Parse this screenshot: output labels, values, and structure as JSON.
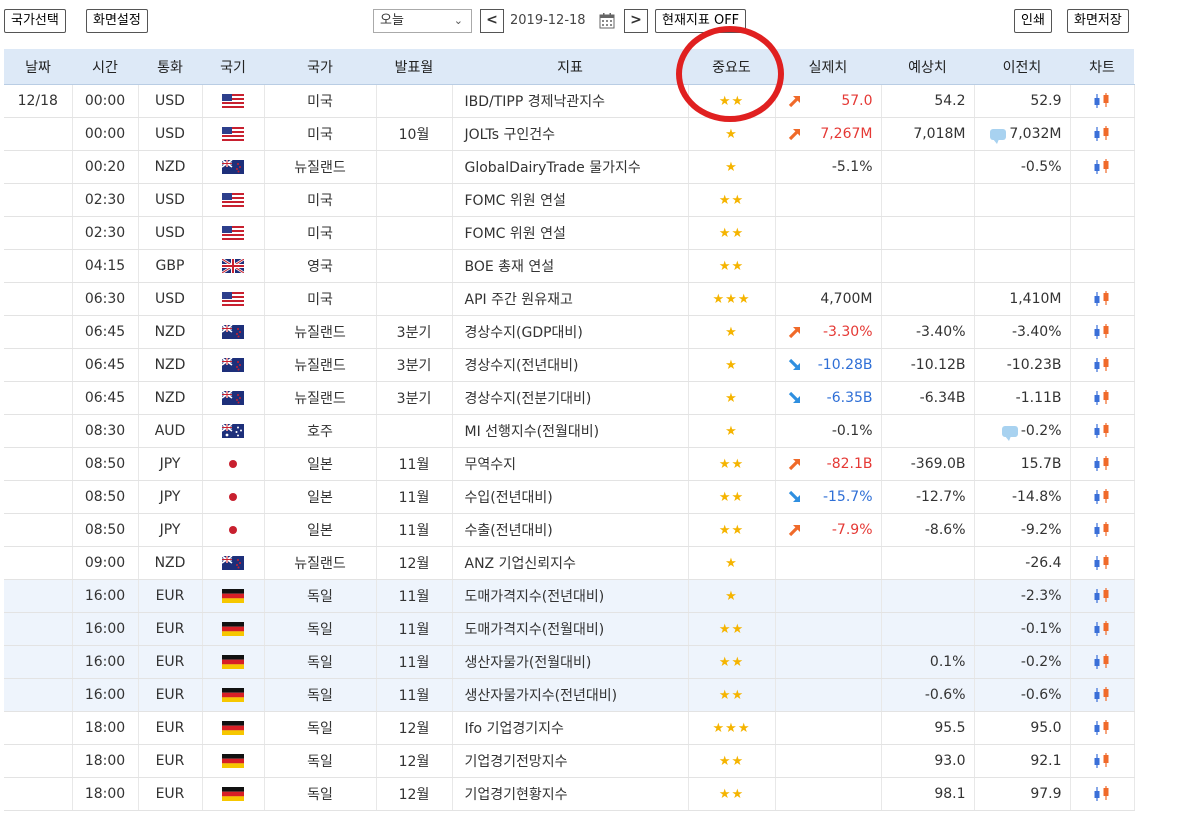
{
  "toolbar": {
    "country_select": "국가선택",
    "screen_settings": "화면설정",
    "period": "오늘",
    "date": "2019-12-18",
    "indicator_toggle": "현재지표 OFF",
    "print": "인쇄",
    "save_screen": "화면저장"
  },
  "headers": [
    "날짜",
    "시간",
    "통화",
    "국기",
    "국가",
    "발표월",
    "지표",
    "중요도",
    "실제치",
    "예상치",
    "이전치",
    "차트"
  ],
  "rows": [
    {
      "date": "12/18",
      "time": "00:00",
      "cur": "USD",
      "flag": "us",
      "country": "미국",
      "month": "",
      "indicator": "IBD/TIPP 경제낙관지수",
      "stars": "★★",
      "actual": "57.0",
      "dir": "up",
      "forecast": "54.2",
      "previous": "52.9",
      "bubble": false,
      "chart": true,
      "hl": false
    },
    {
      "date": "",
      "time": "00:00",
      "cur": "USD",
      "flag": "us",
      "country": "미국",
      "month": "10월",
      "indicator": "JOLTs 구인건수",
      "stars": "★",
      "actual": "7,267M",
      "dir": "up",
      "forecast": "7,018M",
      "previous": "7,032M",
      "bubble": true,
      "chart": true,
      "hl": false
    },
    {
      "date": "",
      "time": "00:20",
      "cur": "NZD",
      "flag": "nz",
      "country": "뉴질랜드",
      "month": "",
      "indicator": "GlobalDairyTrade 물가지수",
      "stars": "★",
      "actual": "-5.1%",
      "dir": "",
      "forecast": "",
      "previous": "-0.5%",
      "bubble": false,
      "chart": true,
      "hl": false
    },
    {
      "date": "",
      "time": "02:30",
      "cur": "USD",
      "flag": "us",
      "country": "미국",
      "month": "",
      "indicator": "FOMC 위원 연설",
      "stars": "★★",
      "actual": "",
      "dir": "",
      "forecast": "",
      "previous": "",
      "bubble": false,
      "chart": false,
      "hl": false
    },
    {
      "date": "",
      "time": "02:30",
      "cur": "USD",
      "flag": "us",
      "country": "미국",
      "month": "",
      "indicator": "FOMC 위원 연설",
      "stars": "★★",
      "actual": "",
      "dir": "",
      "forecast": "",
      "previous": "",
      "bubble": false,
      "chart": false,
      "hl": false
    },
    {
      "date": "",
      "time": "04:15",
      "cur": "GBP",
      "flag": "gb",
      "country": "영국",
      "month": "",
      "indicator": "BOE 총재 연설",
      "stars": "★★",
      "actual": "",
      "dir": "",
      "forecast": "",
      "previous": "",
      "bubble": false,
      "chart": false,
      "hl": false
    },
    {
      "date": "",
      "time": "06:30",
      "cur": "USD",
      "flag": "us",
      "country": "미국",
      "month": "",
      "indicator": "API 주간 원유재고",
      "stars": "★★★",
      "actual": "4,700M",
      "dir": "",
      "forecast": "",
      "previous": "1,410M",
      "bubble": false,
      "chart": true,
      "hl": false
    },
    {
      "date": "",
      "time": "06:45",
      "cur": "NZD",
      "flag": "nz",
      "country": "뉴질랜드",
      "month": "3분기",
      "indicator": "경상수지(GDP대비)",
      "stars": "★",
      "actual": "-3.30%",
      "dir": "up",
      "forecast": "-3.40%",
      "previous": "-3.40%",
      "bubble": false,
      "chart": true,
      "hl": false
    },
    {
      "date": "",
      "time": "06:45",
      "cur": "NZD",
      "flag": "nz",
      "country": "뉴질랜드",
      "month": "3분기",
      "indicator": "경상수지(전년대비)",
      "stars": "★",
      "actual": "-10.28B",
      "dir": "down",
      "forecast": "-10.12B",
      "previous": "-10.23B",
      "bubble": false,
      "chart": true,
      "hl": false
    },
    {
      "date": "",
      "time": "06:45",
      "cur": "NZD",
      "flag": "nz",
      "country": "뉴질랜드",
      "month": "3분기",
      "indicator": "경상수지(전분기대비)",
      "stars": "★",
      "actual": "-6.35B",
      "dir": "down",
      "forecast": "-6.34B",
      "previous": "-1.11B",
      "bubble": false,
      "chart": true,
      "hl": false
    },
    {
      "date": "",
      "time": "08:30",
      "cur": "AUD",
      "flag": "au",
      "country": "호주",
      "month": "",
      "indicator": "MI 선행지수(전월대비)",
      "stars": "★",
      "actual": "-0.1%",
      "dir": "",
      "forecast": "",
      "previous": "-0.2%",
      "bubble": true,
      "chart": true,
      "hl": false
    },
    {
      "date": "",
      "time": "08:50",
      "cur": "JPY",
      "flag": "jp",
      "country": "일본",
      "month": "11월",
      "indicator": "무역수지",
      "stars": "★★",
      "actual": "-82.1B",
      "dir": "up",
      "forecast": "-369.0B",
      "previous": "15.7B",
      "bubble": false,
      "chart": true,
      "hl": false
    },
    {
      "date": "",
      "time": "08:50",
      "cur": "JPY",
      "flag": "jp",
      "country": "일본",
      "month": "11월",
      "indicator": "수입(전년대비)",
      "stars": "★★",
      "actual": "-15.7%",
      "dir": "down",
      "forecast": "-12.7%",
      "previous": "-14.8%",
      "bubble": false,
      "chart": true,
      "hl": false
    },
    {
      "date": "",
      "time": "08:50",
      "cur": "JPY",
      "flag": "jp",
      "country": "일본",
      "month": "11월",
      "indicator": "수출(전년대비)",
      "stars": "★★",
      "actual": "-7.9%",
      "dir": "up",
      "forecast": "-8.6%",
      "previous": "-9.2%",
      "bubble": false,
      "chart": true,
      "hl": false
    },
    {
      "date": "",
      "time": "09:00",
      "cur": "NZD",
      "flag": "nz",
      "country": "뉴질랜드",
      "month": "12월",
      "indicator": "ANZ 기업신뢰지수",
      "stars": "★",
      "actual": "",
      "dir": "",
      "forecast": "",
      "previous": "-26.4",
      "bubble": false,
      "chart": true,
      "hl": false
    },
    {
      "date": "",
      "time": "16:00",
      "cur": "EUR",
      "flag": "de",
      "country": "독일",
      "month": "11월",
      "indicator": "도매가격지수(전년대비)",
      "stars": "★",
      "actual": "",
      "dir": "",
      "forecast": "",
      "previous": "-2.3%",
      "bubble": false,
      "chart": true,
      "hl": true
    },
    {
      "date": "",
      "time": "16:00",
      "cur": "EUR",
      "flag": "de",
      "country": "독일",
      "month": "11월",
      "indicator": "도매가격지수(전월대비)",
      "stars": "★★",
      "actual": "",
      "dir": "",
      "forecast": "",
      "previous": "-0.1%",
      "bubble": false,
      "chart": true,
      "hl": true
    },
    {
      "date": "",
      "time": "16:00",
      "cur": "EUR",
      "flag": "de",
      "country": "독일",
      "month": "11월",
      "indicator": "생산자물가(전월대비)",
      "stars": "★★",
      "actual": "",
      "dir": "",
      "forecast": "0.1%",
      "previous": "-0.2%",
      "bubble": false,
      "chart": true,
      "hl": true
    },
    {
      "date": "",
      "time": "16:00",
      "cur": "EUR",
      "flag": "de",
      "country": "독일",
      "month": "11월",
      "indicator": "생산자물가지수(전년대비)",
      "stars": "★★",
      "actual": "",
      "dir": "",
      "forecast": "-0.6%",
      "previous": "-0.6%",
      "bubble": false,
      "chart": true,
      "hl": true
    },
    {
      "date": "",
      "time": "18:00",
      "cur": "EUR",
      "flag": "de",
      "country": "독일",
      "month": "12월",
      "indicator": "Ifo 기업경기지수",
      "stars": "★★★",
      "actual": "",
      "dir": "",
      "forecast": "95.5",
      "previous": "95.0",
      "bubble": false,
      "chart": true,
      "hl": false
    },
    {
      "date": "",
      "time": "18:00",
      "cur": "EUR",
      "flag": "de",
      "country": "독일",
      "month": "12월",
      "indicator": "기업경기전망지수",
      "stars": "★★",
      "actual": "",
      "dir": "",
      "forecast": "93.0",
      "previous": "92.1",
      "bubble": false,
      "chart": true,
      "hl": false
    },
    {
      "date": "",
      "time": "18:00",
      "cur": "EUR",
      "flag": "de",
      "country": "독일",
      "month": "12월",
      "indicator": "기업경기현황지수",
      "stars": "★★",
      "actual": "",
      "dir": "",
      "forecast": "98.1",
      "previous": "97.9",
      "bubble": false,
      "chart": true,
      "hl": false
    }
  ],
  "colors": {
    "header_bg": "#dde9f7",
    "up": "#e53935",
    "down": "#2f6fd6",
    "star": "#f5b400",
    "highlight": "#e02020"
  }
}
